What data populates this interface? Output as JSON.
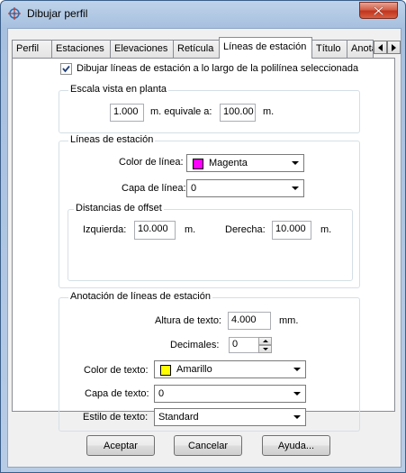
{
  "window": {
    "title": "Dibujar perfil",
    "close_icon": "close-icon"
  },
  "tabs": [
    {
      "label": "Perfil"
    },
    {
      "label": "Estaciones"
    },
    {
      "label": "Elevaciones"
    },
    {
      "label": "Retícula"
    },
    {
      "label": "Líneas de estación"
    },
    {
      "label": "Título"
    },
    {
      "label": "Anotaciones"
    }
  ],
  "active_tab": "Líneas de estación",
  "draw_lines": {
    "label": "Dibujar líneas de estación a lo largo de la polilínea seleccionada",
    "checked": true
  },
  "scale_group": {
    "title": "Escala vista en planta",
    "value1": "1.000",
    "mid_label": "m. equivale a:",
    "value2": "100.00",
    "unit": "m."
  },
  "station_lines_group": {
    "title": "Líneas de estación",
    "color_label": "Color de línea:",
    "color_value": "Magenta",
    "color_hex": "#ff00ff",
    "layer_label": "Capa de línea:",
    "layer_value": "0",
    "offset_group": {
      "title": "Distancias de offset",
      "left_label": "Izquierda:",
      "left_value": "10.000",
      "left_unit": "m.",
      "right_label": "Derecha:",
      "right_value": "10.000",
      "right_unit": "m."
    }
  },
  "annotation_group": {
    "title": "Anotación de líneas de estación",
    "height_label": "Altura de texto:",
    "height_value": "4.000",
    "height_unit": "mm.",
    "decimals_label": "Decimales:",
    "decimals_value": "0",
    "color_label": "Color de texto:",
    "color_value": "Amarillo",
    "color_hex": "#ffff00",
    "layer_label": "Capa de texto:",
    "layer_value": "0",
    "style_label": "Estilo de texto:",
    "style_value": "Standard"
  },
  "buttons": {
    "ok": "Aceptar",
    "cancel": "Cancelar",
    "help": "Ayuda..."
  }
}
